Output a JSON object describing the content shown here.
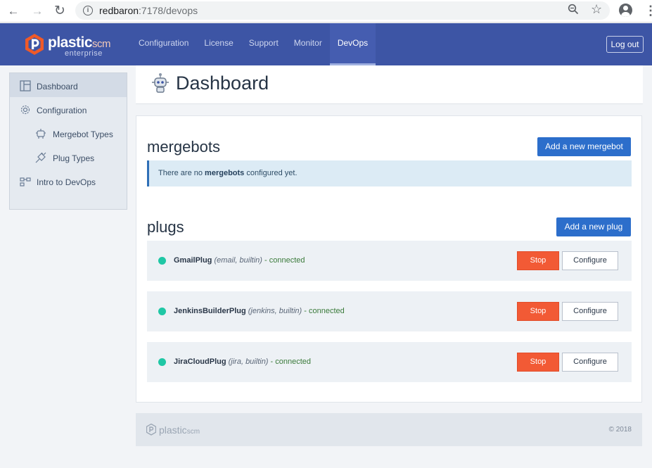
{
  "browser": {
    "url_host": "redbaron",
    "url_rest": ":7178/devops",
    "back_icon": "←",
    "forward_icon": "→",
    "reload_icon": "↻"
  },
  "header": {
    "logo_main": "plastic",
    "logo_scm": "scm",
    "logo_sub": "enterprise",
    "nav": [
      "Configuration",
      "License",
      "Support",
      "Monitor",
      "DevOps"
    ],
    "active_tab": "DevOps",
    "logout_label": "Log out",
    "brand_color": "#3d55a5",
    "logo_color": "#f05a28"
  },
  "sidebar": {
    "items": [
      {
        "label": "Dashboard",
        "icon": "dashboard-icon",
        "active": true
      },
      {
        "label": "Configuration",
        "icon": "gear-icon",
        "active": false
      },
      {
        "label": "Mergebot Types",
        "icon": "robot-icon",
        "active": false
      },
      {
        "label": "Plug Types",
        "icon": "plug-icon",
        "active": false
      },
      {
        "label": "Intro to DevOps",
        "icon": "flow-icon",
        "active": false
      }
    ]
  },
  "page": {
    "title": "Dashboard",
    "icon": "robot-icon"
  },
  "mergebots": {
    "title": "mergebots",
    "add_label": "Add a new mergebot",
    "notice_before": "There are no ",
    "notice_bold": "mergebots",
    "notice_after": " configured yet."
  },
  "plugs": {
    "title": "plugs",
    "add_label": "Add a new plug",
    "items": [
      {
        "name": "GmailPlug",
        "tags": "(email, builtin)",
        "status": "- connected",
        "stop_label": "Stop",
        "configure_label": "Configure"
      },
      {
        "name": "JenkinsBuilderPlug",
        "tags": "(jenkins, builtin)",
        "status": "- connected",
        "stop_label": "Stop",
        "configure_label": "Configure"
      },
      {
        "name": "JiraCloudPlug",
        "tags": "(jira, builtin)",
        "status": "- connected",
        "stop_label": "Stop",
        "configure_label": "Configure"
      }
    ],
    "status_color": "#1fc7a5",
    "stop_color": "#f25a35"
  },
  "footer": {
    "logo_main": "plastic",
    "logo_scm": "scm",
    "copyright": "© 2018"
  }
}
